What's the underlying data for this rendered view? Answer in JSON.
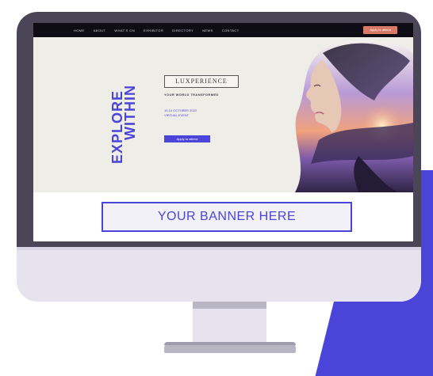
{
  "nav": {
    "links": [
      "Home",
      "About",
      "What's On",
      "Exhibitor",
      "Directory",
      "News",
      "Contact"
    ],
    "cta": "Apply to attend"
  },
  "hero": {
    "headline_line1": "EXPLORE",
    "headline_line2": "WITHIN",
    "brand": "LUXPERIENCE",
    "tagline": "YOUR WORLD TRANSFORMED",
    "date_line1": "10-12 OCTOBER 2022",
    "date_line2": "VIRTUAL EVENT",
    "button": "Apply to attend"
  },
  "banner": {
    "text": "YOUR BANNER HERE"
  },
  "colors": {
    "accent": "#4b44d8",
    "cta": "#d97a68",
    "bezel": "#4a4658",
    "nav_bg": "#0e0d16"
  }
}
